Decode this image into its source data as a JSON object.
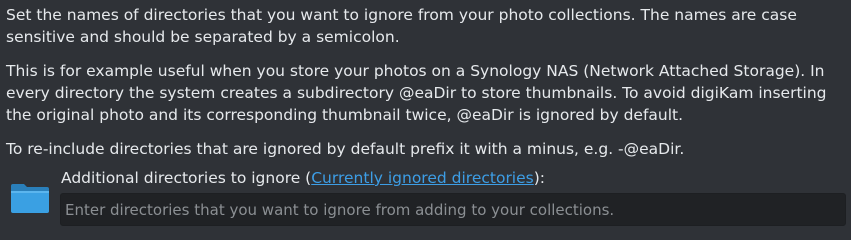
{
  "paragraphs": {
    "p1": "Set the names of directories that you want to ignore from your photo collections. The names are case sensitive and should be separated by a semicolon.",
    "p2": "This is for example useful when you store your photos on a Synology NAS (Network Attached Storage). In every directory the system creates a subdirectory @eaDir to store thumbnails. To avoid digiKam inserting the original photo and its corresponding thumbnail twice, @eaDir is ignored by default.",
    "p3": "To re-include directories that are ignored by default prefix it with a minus, e.g. -@eaDir."
  },
  "ignore_field": {
    "label_prefix": "Additional directories to ignore (",
    "link_text": "Currently ignored directories",
    "label_suffix": "):",
    "placeholder": "Enter directories that you want to ignore from adding to your collections.",
    "value": ""
  },
  "icons": {
    "folder": "folder-icon"
  },
  "colors": {
    "background": "#2f3237",
    "text": "#e6e9ec",
    "link": "#3d9ee6",
    "folder": "#3aa0e3",
    "input_background": "#202225"
  }
}
